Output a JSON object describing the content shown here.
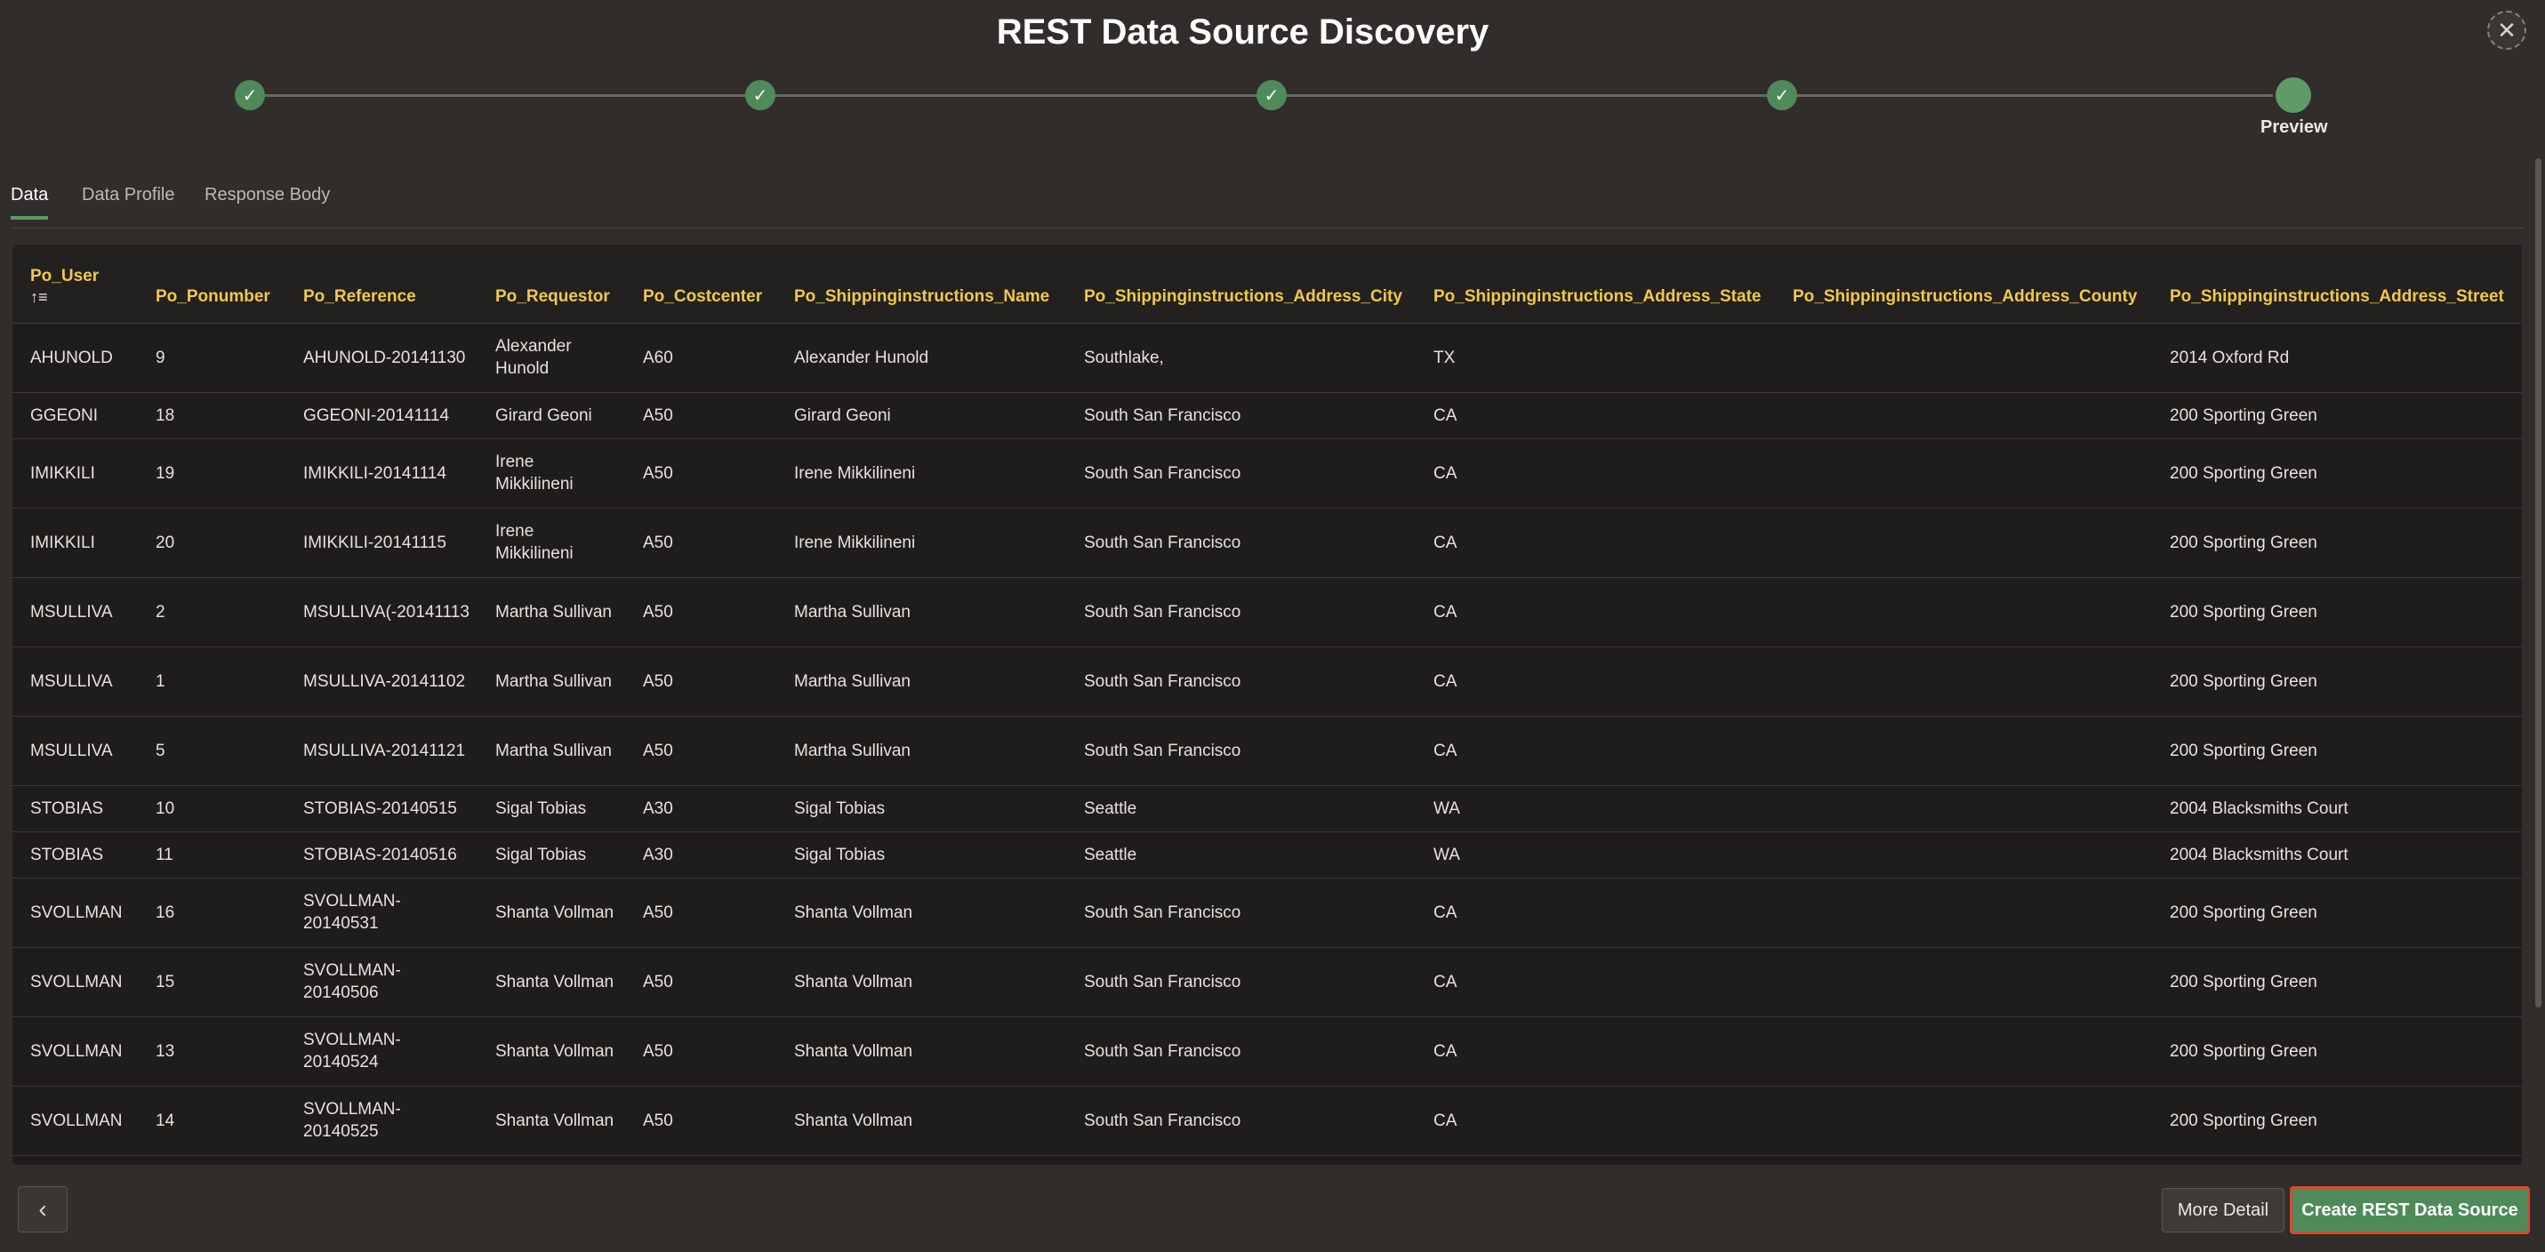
{
  "dialog": {
    "title": "REST Data Source Discovery",
    "close_icon": "close-icon"
  },
  "wizard": {
    "steps": [
      {
        "status": "complete",
        "icon": "check-icon",
        "label": ""
      },
      {
        "status": "complete",
        "icon": "check-icon",
        "label": ""
      },
      {
        "status": "complete",
        "icon": "check-icon",
        "label": ""
      },
      {
        "status": "complete",
        "icon": "check-icon",
        "label": ""
      },
      {
        "status": "current",
        "icon": "",
        "label": "Preview"
      }
    ]
  },
  "tabs": [
    {
      "label": "Data",
      "active": true
    },
    {
      "label": "Data Profile",
      "active": false
    },
    {
      "label": "Response Body",
      "active": false
    }
  ],
  "table": {
    "columns": [
      "Po_User",
      "Po_Ponumber",
      "Po_Reference",
      "Po_Requestor",
      "Po_Costcenter",
      "Po_Shippinginstructions_Name",
      "Po_Shippinginstructions_Address_City",
      "Po_Shippinginstructions_Address_State",
      "Po_Shippinginstructions_Address_County",
      "Po_Shippinginstructions_Address_Street"
    ],
    "sort_icon": "sort-ascending-icon",
    "rows": [
      [
        "AHUNOLD",
        "9",
        "AHUNOLD-20141130",
        "Alexander Hunold",
        "A60",
        "Alexander Hunold",
        "Southlake,",
        "TX",
        "",
        "2014 Oxford Rd"
      ],
      [
        "GGEONI",
        "18",
        "GGEONI-20141114",
        "Girard Geoni",
        "A50",
        "Girard Geoni",
        "South San Francisco",
        "CA",
        "",
        "200 Sporting Green"
      ],
      [
        "IMIKKILI",
        "19",
        "IMIKKILI-20141114",
        "Irene Mikkilineni",
        "A50",
        "Irene Mikkilineni",
        "South San Francisco",
        "CA",
        "",
        "200 Sporting Green"
      ],
      [
        "IMIKKILI",
        "20",
        "IMIKKILI-20141115",
        "Irene Mikkilineni",
        "A50",
        "Irene Mikkilineni",
        "South San Francisco",
        "CA",
        "",
        "200 Sporting Green"
      ],
      [
        "MSULLIVA",
        "2",
        "MSULLIVA(-20141113",
        "Martha Sullivan",
        "A50",
        "Martha Sullivan",
        "South San Francisco",
        "CA",
        "",
        "200 Sporting Green"
      ],
      [
        "MSULLIVA",
        "1",
        "MSULLIVA-20141102",
        "Martha Sullivan",
        "A50",
        "Martha Sullivan",
        "South San Francisco",
        "CA",
        "",
        "200 Sporting Green"
      ],
      [
        "MSULLIVA",
        "5",
        "MSULLIVA-20141121",
        "Martha Sullivan",
        "A50",
        "Martha Sullivan",
        "South San Francisco",
        "CA",
        "",
        "200 Sporting Green"
      ],
      [
        "STOBIAS",
        "10",
        "STOBIAS-20140515",
        "Sigal Tobias",
        "A30",
        "Sigal Tobias",
        "Seattle",
        "WA",
        "",
        "2004 Blacksmiths Court"
      ],
      [
        "STOBIAS",
        "11",
        "STOBIAS-20140516",
        "Sigal Tobias",
        "A30",
        "Sigal Tobias",
        "Seattle",
        "WA",
        "",
        "2004 Blacksmiths Court"
      ],
      [
        "SVOLLMAN",
        "16",
        "SVOLLMAN-20140531",
        "Shanta Vollman",
        "A50",
        "Shanta Vollman",
        "South San Francisco",
        "CA",
        "",
        "200 Sporting Green"
      ],
      [
        "SVOLLMAN",
        "15",
        "SVOLLMAN-20140506",
        "Shanta Vollman",
        "A50",
        "Shanta Vollman",
        "South San Francisco",
        "CA",
        "",
        "200 Sporting Green"
      ],
      [
        "SVOLLMAN",
        "13",
        "SVOLLMAN-20140524",
        "Shanta Vollman",
        "A50",
        "Shanta Vollman",
        "South San Francisco",
        "CA",
        "",
        "200 Sporting Green"
      ],
      [
        "SVOLLMAN",
        "14",
        "SVOLLMAN-20140525",
        "Shanta Vollman",
        "A50",
        "Shanta Vollman",
        "South San Francisco",
        "CA",
        "",
        "200 Sporting Green"
      ]
    ]
  },
  "footer": {
    "back_icon": "chevron-left-icon",
    "more_detail_label": "More Detail",
    "create_label": "Create REST Data Source"
  },
  "colors": {
    "background": "#312d2a",
    "accent_green": "#4f8a5a",
    "header_text": "#f1c84b",
    "highlight_border": "#d84a2f"
  }
}
